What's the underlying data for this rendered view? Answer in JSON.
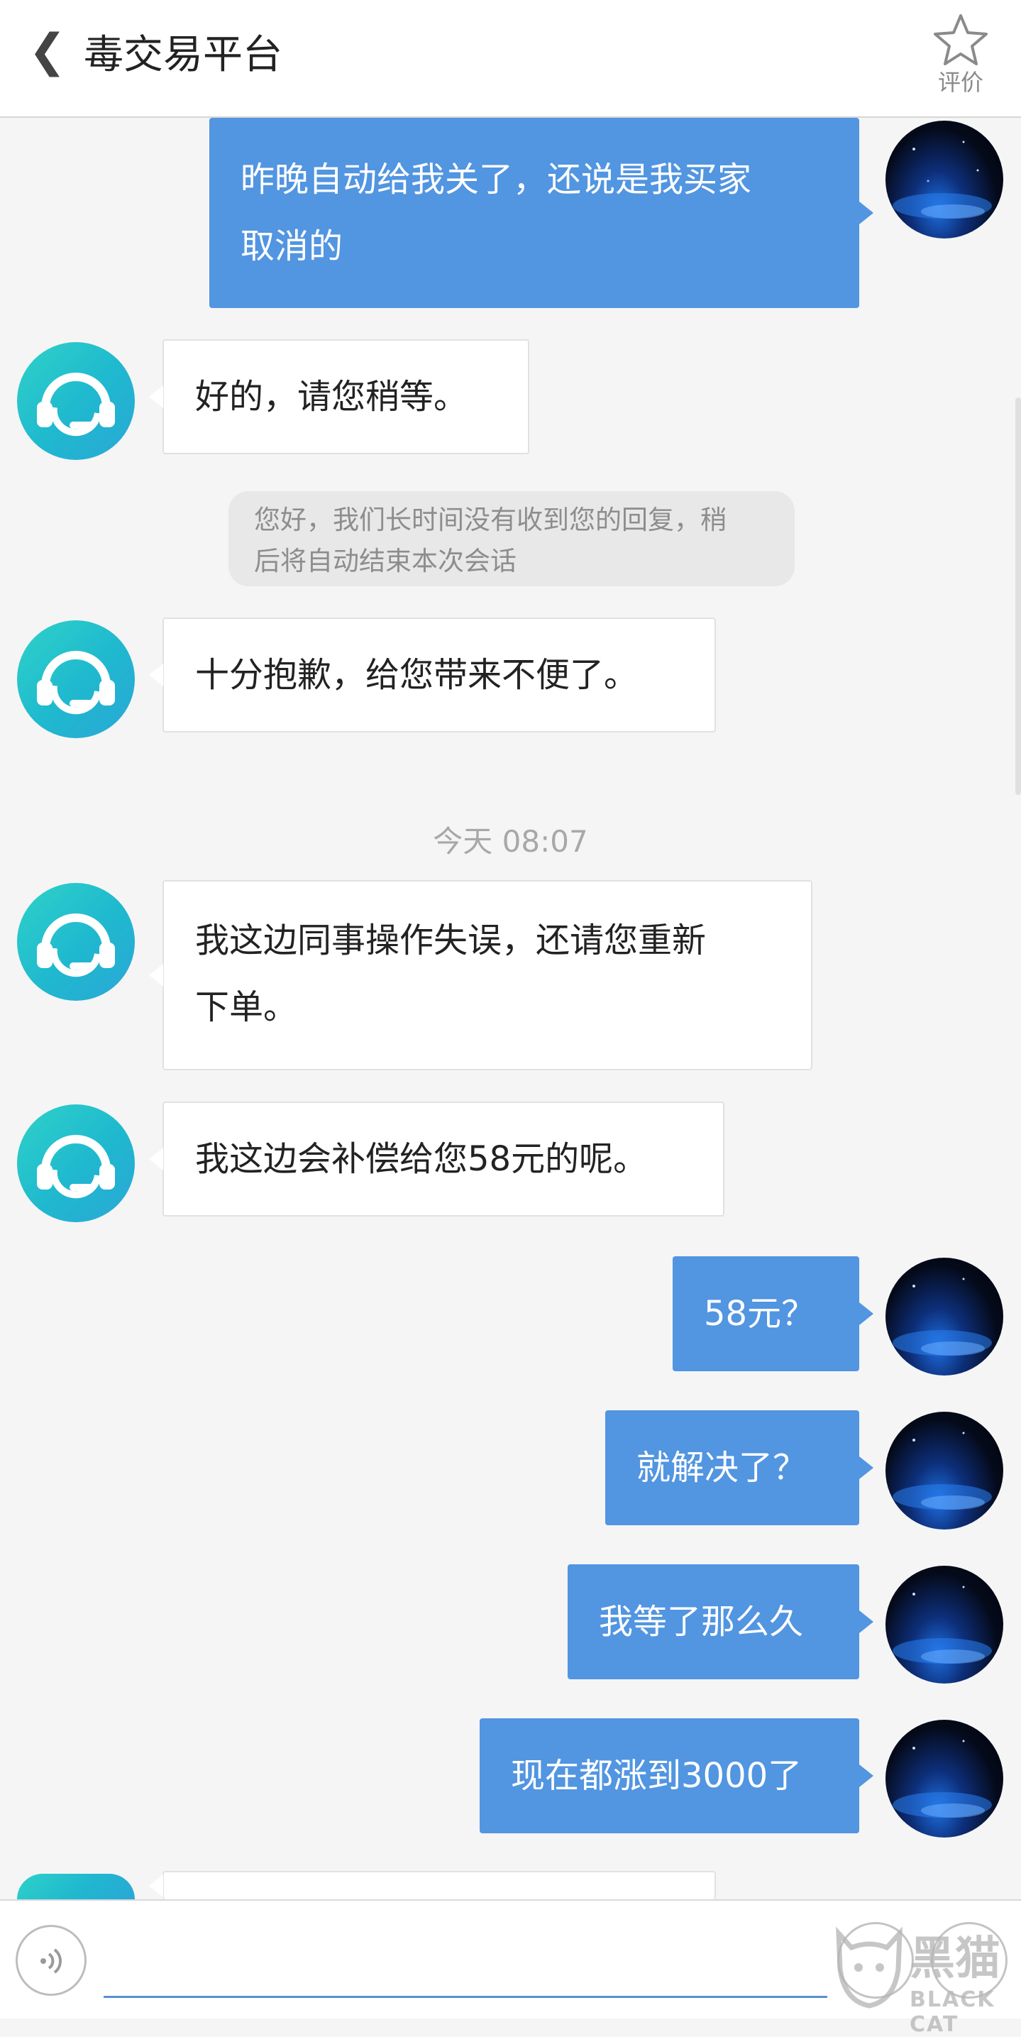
{
  "header": {
    "back_icon": "chevron-left-icon",
    "back_glyph": "❮",
    "title": "毒交易平台",
    "rate_label": "评价",
    "rate_icon": "star-outline-icon"
  },
  "messages": [
    {
      "side": "right",
      "lines": [
        "昨晚自动给我关了，还说是我买家",
        "取消的"
      ]
    },
    {
      "side": "left",
      "text": "好的，请您稍等。"
    },
    {
      "side": "system",
      "lines": [
        "您好，我们长时间没有收到您的回复，稍",
        "后将自动结束本次会话"
      ]
    },
    {
      "side": "left",
      "text": "十分抱歉，给您带来不便了。"
    },
    {
      "side": "left",
      "lines": [
        "我这边同事操作失误，还请您重新",
        "下单。"
      ]
    },
    {
      "side": "left",
      "text": "我这边会补偿给您58元的呢。"
    },
    {
      "side": "right",
      "text": "58元？"
    },
    {
      "side": "right",
      "text": "就解决了？"
    },
    {
      "side": "right",
      "text": "我等了那么久"
    },
    {
      "side": "right",
      "text": "现在都涨到3000了"
    }
  ],
  "time_divider": "今天 08:07",
  "bottom_bar": {
    "voice_icon": "voice-input-icon",
    "input_value": ""
  },
  "watermark": {
    "text": "黑猫",
    "subtext": "BLACK CAT"
  },
  "colors": {
    "user_bubble": "#5295e1",
    "agent_bubble": "#ffffff",
    "background": "#f5f5f5",
    "agent_avatar": "#2ec4cc"
  }
}
